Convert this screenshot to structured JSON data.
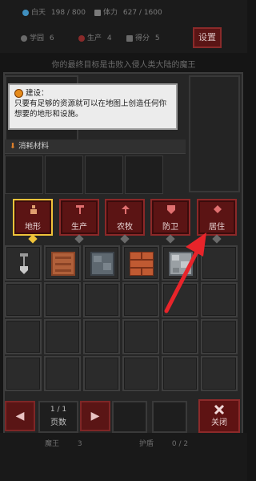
{
  "status": {
    "daytime_label": "白天",
    "daytime_value": "198 / 800",
    "stamina_label": "体力",
    "stamina_value": "627 / 1600",
    "camp_label": "学园",
    "camp_value": "6",
    "growth_label": "生产",
    "growth_value": "4",
    "score_label": "得分",
    "score_value": "5",
    "settings_label": "设置"
  },
  "goal_text": "你的最终目标是击败入侵人类大陆的魔王",
  "advice": {
    "title": "建设：",
    "body": "只要有足够的资源就可以在地图上创造任何你想要的地形和设施。"
  },
  "consume_header": "消耗材料",
  "categories": [
    {
      "label": "地形",
      "icon": "terrain-icon",
      "selected": true
    },
    {
      "label": "生产",
      "icon": "production-icon",
      "selected": false
    },
    {
      "label": "农牧",
      "icon": "farming-icon",
      "selected": false
    },
    {
      "label": "防卫",
      "icon": "shield-icon",
      "selected": false
    },
    {
      "label": "居住",
      "icon": "house-icon",
      "selected": false
    }
  ],
  "tiles": [
    "shovel-icon",
    "dirt-tile",
    "stone-tile",
    "brick-tile",
    "rock-tile"
  ],
  "pager": {
    "current": "1",
    "total": "1",
    "label": "页数"
  },
  "nav": {
    "prev": "◀",
    "next": "▶"
  },
  "close_label": "关闭",
  "bottom": {
    "left_label": "魔王",
    "left_value": "3",
    "right_label": "护盾",
    "right_value": "0 / 2"
  },
  "colors": {
    "accent_red": "#5b1414",
    "selected_gold": "#f0c33a",
    "pointer_arrow": "#e8242a"
  }
}
